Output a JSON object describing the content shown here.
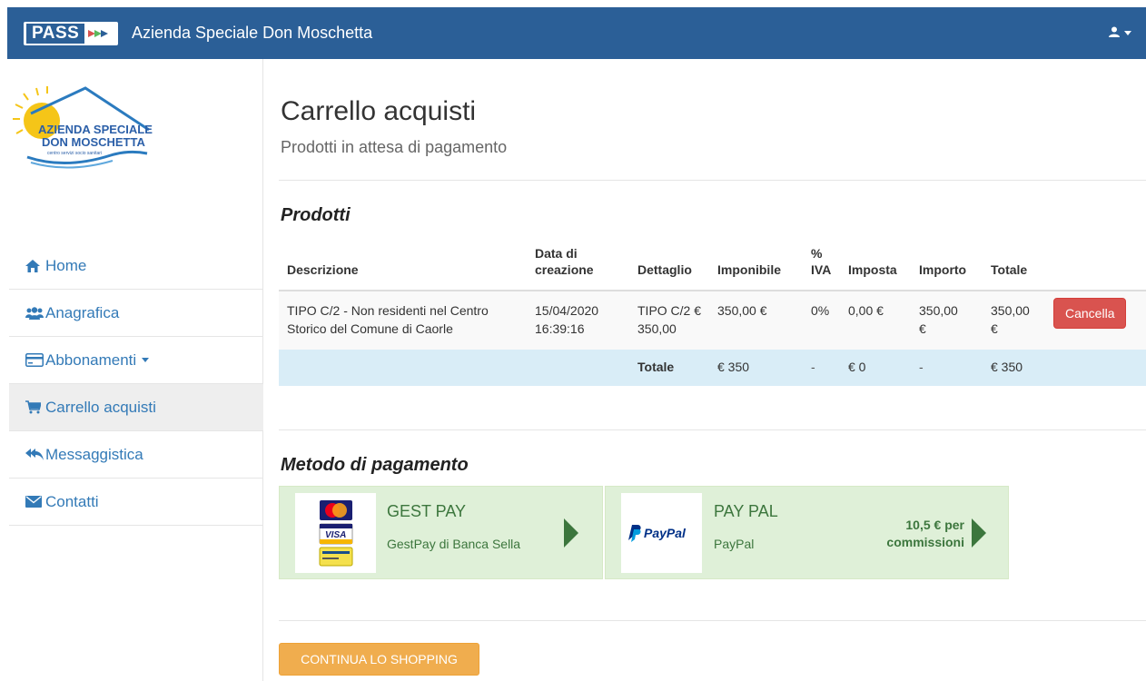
{
  "header": {
    "logo_text": "PASS",
    "app_title": "Azienda Speciale Don Moschetta",
    "user_icon": "user-icon"
  },
  "sidebar": {
    "logo": {
      "line1": "AZIENDA SPECIALE",
      "line2": "DON MOSCHETTA",
      "line3": "centro servizi socio sanitari"
    },
    "items": [
      {
        "label": "Home",
        "icon": "home-icon"
      },
      {
        "label": "Anagrafica",
        "icon": "users-icon"
      },
      {
        "label": "Abbonamenti",
        "icon": "credit-card-icon"
      },
      {
        "label": "Carrello acquisti",
        "icon": "shopping-cart-icon"
      },
      {
        "label": "Messaggistica",
        "icon": "reply-all-icon"
      },
      {
        "label": "Contatti",
        "icon": "envelope-icon"
      }
    ]
  },
  "page": {
    "title": "Carrello acquisti",
    "subtitle": "Prodotti in attesa di pagamento"
  },
  "products": {
    "section_title": "Prodotti",
    "columns": {
      "descrizione": "Descrizione",
      "data_line1": "Data di",
      "data_line2": "creazione",
      "dettaglio": "Dettaglio",
      "imponibile": "Imponibile",
      "iva_line1": "%",
      "iva_line2": "IVA",
      "imposta": "Imposta",
      "importo": "Importo",
      "totale": "Totale"
    },
    "row": {
      "desc_line1": "TIPO C/2 - Non residenti nel Centro",
      "desc_line2": "Storico del Comune di Caorle",
      "date": "15/04/2020",
      "time": "16:39:16",
      "detail_line1": "TIPO C/2 €",
      "detail_line2": "350,00",
      "imponibile": "350,00 €",
      "iva": "0%",
      "imposta": "0,00 €",
      "importo_line1": "350,00",
      "importo_line2": "€",
      "totale_line1": "350,00",
      "totale_line2": "€",
      "delete_label": "Cancella"
    },
    "totals": {
      "label": "Totale",
      "imponibile": "€ 350",
      "iva": "-",
      "imposta": "€ 0",
      "importo": "-",
      "totale": "€ 350"
    }
  },
  "payment": {
    "section_title": "Metodo di pagamento",
    "methods": [
      {
        "name": "GEST PAY",
        "description": "GestPay di Banca Sella",
        "logo_icon": "credit-cards-icon"
      },
      {
        "name": "PAY PAL",
        "description": "PayPal",
        "logo_text": "PayPal",
        "commission_line1": "10,5 € per",
        "commission_line2": "commissioni"
      }
    ]
  },
  "actions": {
    "continue_label": "CONTINUA LO SHOPPING"
  },
  "colors": {
    "navbar": "#2b5f97",
    "link": "#337ab7",
    "danger": "#d9534f",
    "warning": "#f0ad4e",
    "success_bg": "#dff0d8",
    "success_text": "#3c763d",
    "info_bg": "#d9edf7"
  }
}
